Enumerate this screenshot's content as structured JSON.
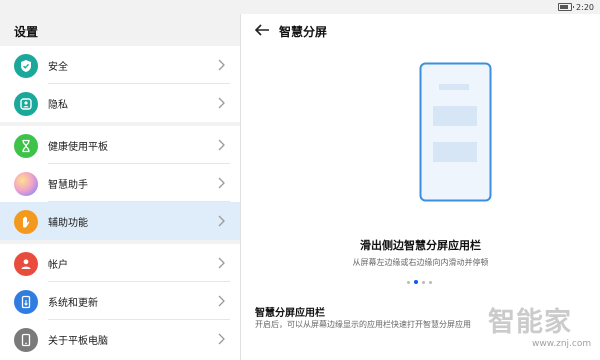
{
  "status_bar": {
    "time": "2:20"
  },
  "left_panel": {
    "title": "设置",
    "items": [
      {
        "label": "安全",
        "icon": "shield-check-icon",
        "color": "#1aa89b"
      },
      {
        "label": "隐私",
        "icon": "privacy-lock-icon",
        "color": "#1aa89b"
      },
      {
        "label": "健康使用平板",
        "icon": "hourglass-icon",
        "color": "#3ec24a"
      },
      {
        "label": "智慧助手",
        "icon": "ai-assistant-orb-icon",
        "color": "#b583e6"
      },
      {
        "label": "辅助功能",
        "icon": "hand-icon",
        "color": "#f39a1e",
        "selected": true
      },
      {
        "label": "帐户",
        "icon": "user-icon",
        "color": "#e94b3c"
      },
      {
        "label": "系统和更新",
        "icon": "phone-update-icon",
        "color": "#2f7de1"
      },
      {
        "label": "关于平板电脑",
        "icon": "tablet-info-icon",
        "color": "#7a7a7a"
      }
    ]
  },
  "right_panel": {
    "title": "智慧分屏",
    "feature_title": "滑出侧边智慧分屏应用栏",
    "feature_desc": "从屏幕左边缘或右边缘向内滑动并停顿",
    "pager": {
      "count": 4,
      "active": 1
    },
    "setting_title": "智慧分屏应用栏",
    "setting_desc": "开启后，可以从屏幕边缘显示的应用栏快速打开智慧分屏应用"
  },
  "watermark": {
    "text": "智能家",
    "url": "www.znj.com"
  }
}
